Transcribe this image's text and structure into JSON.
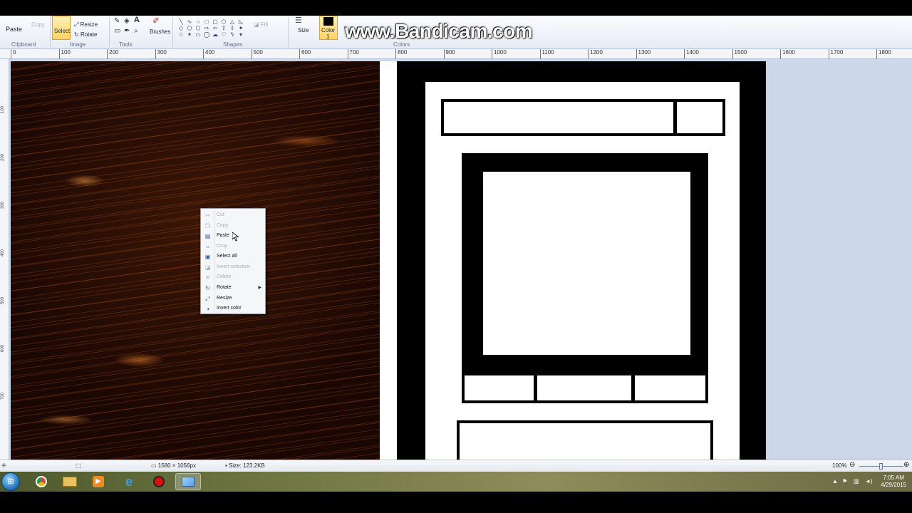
{
  "ribbon": {
    "paste_label": "Paste",
    "copy_label": "Copy",
    "clipboard_label": "Clipboard",
    "select_label": "Select",
    "resize_label": "Resize",
    "rotate_label": "Rotate",
    "image_label": "Image",
    "tools_label": "Tools",
    "brushes_label": "Brushes",
    "shapes_label": "Shapes",
    "fill_label": "Fill",
    "size_label": "Size",
    "color1_label": "Color",
    "color1_number": "1",
    "colors_label": "Colors"
  },
  "watermark": "www.Bandicam.com",
  "ruler": {
    "h_ticks": [
      "0",
      "100",
      "200",
      "300",
      "400",
      "500",
      "600",
      "700",
      "800",
      "900",
      "1000",
      "1100",
      "1200",
      "1300",
      "1400",
      "1500",
      "1600",
      "1700",
      "1800"
    ],
    "v_ticks": [
      "100",
      "200",
      "300",
      "400",
      "500",
      "600",
      "700"
    ]
  },
  "context_menu": {
    "items": [
      {
        "label": "Cut",
        "icon": "scissors-icon",
        "disabled": true
      },
      {
        "label": "Copy",
        "icon": "copy-icon",
        "disabled": true
      },
      {
        "label": "Paste",
        "icon": "paste-icon",
        "disabled": false
      },
      {
        "label": "Crop",
        "icon": "crop-icon",
        "disabled": true
      },
      {
        "label": "Select all",
        "icon": "select-all-icon",
        "disabled": false
      },
      {
        "label": "Invert selection",
        "icon": "invert-selection-icon",
        "disabled": true
      },
      {
        "label": "Delete",
        "icon": "delete-icon",
        "disabled": true
      },
      {
        "label": "Rotate",
        "icon": "rotate-icon",
        "disabled": false,
        "submenu": true
      },
      {
        "label": "Resize",
        "icon": "resize-icon",
        "disabled": false
      },
      {
        "label": "Invert color",
        "icon": "invert-color-icon",
        "disabled": false
      }
    ]
  },
  "status": {
    "dimensions": "1580 × 1056px",
    "size": "Size: 123.2KB",
    "zoom": "100%"
  },
  "taskbar": {
    "time": "7:05 AM",
    "date": "4/29/2015",
    "apps": [
      "start-icon",
      "chrome-icon",
      "file-explorer-icon",
      "media-player-icon",
      "internet-explorer-icon",
      "bandicam-icon",
      "paint-icon"
    ]
  },
  "colors": {
    "ribbon_bg": "#e6ecf5",
    "workspace_bg": "#ccd7e8",
    "select_highlight": "#ffd35e"
  }
}
